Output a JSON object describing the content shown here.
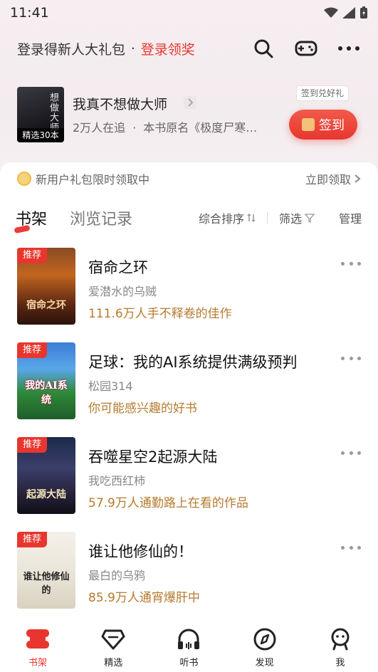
{
  "status": {
    "time": "11:41"
  },
  "header": {
    "login_text": "登录得新人大礼包",
    "dot": "·",
    "login_link": "登录领奖"
  },
  "promo": {
    "cover_tag": "精选30本",
    "cover_title": "想做大师",
    "title": "我真不想做大师",
    "followers": "2万人在追",
    "sub_dot": "·",
    "original_name": "本书原名《极度尸寒…",
    "sign_hint": "签到兑好礼",
    "sign_label": "签到"
  },
  "newuser": {
    "text": "新用户礼包限时领取中",
    "link": "立即领取"
  },
  "tabs": {
    "bookshelf": "书架",
    "history": "浏览记录",
    "sort": "综合排序",
    "filter": "筛选",
    "manage": "管理"
  },
  "books": [
    {
      "badge": "推荐",
      "title": "宿命之环",
      "author": "爱潜水的乌贼",
      "tagline": "111.6万人手不释卷的佳作",
      "cover_text": "宿命之环"
    },
    {
      "badge": "推荐",
      "title": "足球：我的AI系统提供满级预判",
      "author": "松园314",
      "tagline": "你可能感兴趣的好书",
      "cover_text": "我的AI系统"
    },
    {
      "badge": "推荐",
      "title": "吞噬星空2起源大陆",
      "author": "我吃西红柿",
      "tagline": "57.9万人通勤路上在看的作品",
      "cover_text": "起源大陆"
    },
    {
      "badge": "推荐",
      "title": "谁让他修仙的！",
      "author": "最白的乌鸦",
      "tagline": "85.9万人通宵爆肝中",
      "cover_text": "谁让他修仙的"
    }
  ],
  "nav": {
    "bookshelf": "书架",
    "featured": "精选",
    "listen": "听书",
    "discover": "发现",
    "me": "我"
  },
  "colors": {
    "accent": "#e8362e",
    "tagline": "#b57a2f"
  }
}
